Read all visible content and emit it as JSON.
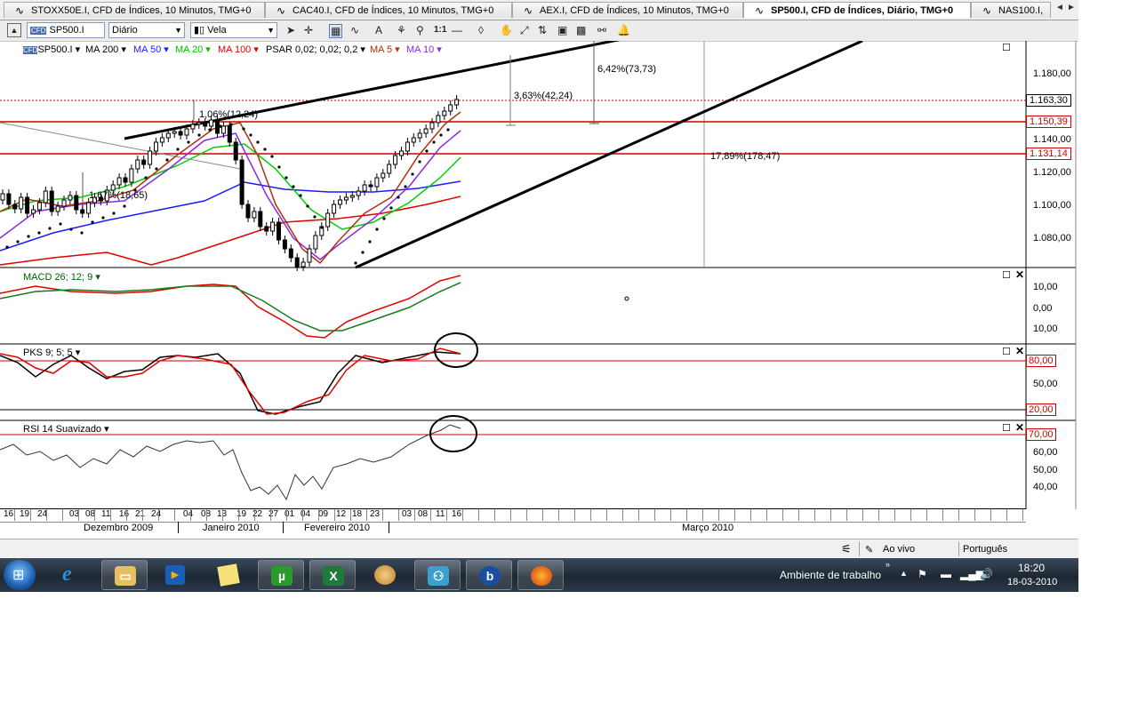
{
  "tabs": [
    {
      "label": "STOXX50E.I, CFD de Índices, 10 Minutos, TMG+0",
      "active": false
    },
    {
      "label": "CAC40.I, CFD de Índices, 10 Minutos, TMG+0",
      "active": false
    },
    {
      "label": "AEX.I, CFD de Índices, 10 Minutos, TMG+0",
      "active": false
    },
    {
      "label": "SP500.I, CFD de Índices, Diário, TMG+0",
      "active": true
    },
    {
      "label": "NAS100.I,",
      "active": false
    }
  ],
  "toolbar": {
    "symbol": "SP500.I",
    "period": "Diário",
    "chart_type": "Vela"
  },
  "legend": {
    "symbol": "SP500.I",
    "ma200": "MA 200",
    "ma50": "MA 50",
    "ma20": "MA 20",
    "ma100": "MA 100",
    "psar": "PSAR 0,02; 0,02; 0,2",
    "ma5": "MA 5",
    "ma10": "MA 10"
  },
  "colors": {
    "ma50": "#1a1aff",
    "ma20": "#00d000",
    "ma100": "#e00000",
    "ma5": "#b03010",
    "ma10": "#8b2be0",
    "hline": "#cc0000",
    "price_tag": "#cc0000"
  },
  "price_axis": {
    "ticks": [
      "1.180,00",
      "1.160,00",
      "1.140,00",
      "1.120,00",
      "1.100,00",
      "1.080,00"
    ],
    "current": "1.163,30",
    "level1": "1.150,39",
    "level2": "1.131,14"
  },
  "annotations": {
    "a1": "1,06%(12,24)",
    "a2": "3,63%(42,24)",
    "a3": "6,42%(73,73)",
    "a4": "17,89%(178,47)",
    "a5": "1,67%(18,65)"
  },
  "macd": {
    "label": "MACD 26; 12; 9",
    "ticks": [
      "10,00",
      "0,00",
      "10,00"
    ]
  },
  "pks": {
    "label": "PKS 9; 5; 5",
    "ticks": [
      "80,00",
      "50,00",
      "20,00"
    ]
  },
  "rsi": {
    "label": "RSI 14 Suavizado",
    "ticks": [
      "70,00",
      "60,00",
      "50,00",
      "40,00"
    ]
  },
  "date_axis": {
    "days": [
      "16",
      "19",
      "24",
      "03",
      "08",
      "11",
      "16",
      "21",
      "24",
      "04",
      "08",
      "13",
      "19",
      "22",
      "27",
      "01",
      "04",
      "09",
      "12",
      "18",
      "23",
      "03",
      "08",
      "11",
      "16"
    ],
    "months": [
      "Dezembro 2009",
      "Janeiro 2010",
      "Fevereiro 2010",
      "Março 2010"
    ]
  },
  "status": {
    "mode": "Ao vivo",
    "language": "Português"
  },
  "taskbar": {
    "desktop_label": "Ambiente de trabalho",
    "time": "18:20",
    "date": "18-03-2010"
  }
}
